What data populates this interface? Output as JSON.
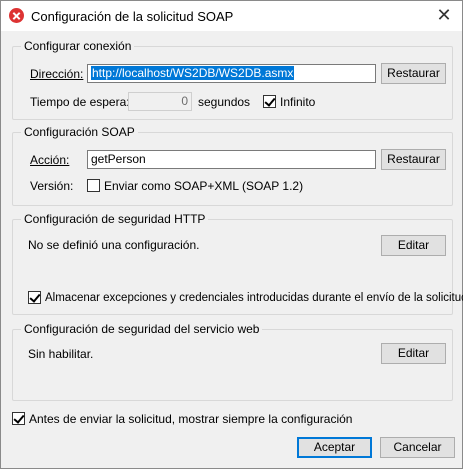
{
  "window": {
    "title": "Configuración de la solicitud SOAP",
    "close_glyph": "✕"
  },
  "connection": {
    "legend": "Configurar conexión",
    "address_label": "Dirección:",
    "address_value": "http://localhost/WS2DB/WS2DB.asmx",
    "restore_label": "Restaurar",
    "timeout_label": "Tiempo de espera:",
    "timeout_value": "0",
    "timeout_unit": "segundos",
    "infinite_label": "Infinito",
    "infinite_checked": true
  },
  "soap": {
    "legend": "Configuración SOAP",
    "action_label": "Acción:",
    "action_value": "getPerson",
    "restore_label": "Restaurar",
    "version_label": "Versión:",
    "soap12_label": "Enviar como SOAP+XML (SOAP 1.2)",
    "soap12_checked": false
  },
  "http_security": {
    "legend": "Configuración de seguridad HTTP",
    "status_text": "No se definió una configuración.",
    "edit_label": "Editar",
    "store_label": "Almacenar excepciones y credenciales introducidas durante el envío de la solicitud",
    "store_checked": true
  },
  "ws_security": {
    "legend": "Configuración de seguridad del servicio web",
    "status_text": "Sin habilitar.",
    "edit_label": "Editar"
  },
  "footer": {
    "always_show_label": "Antes de enviar la solicitud, mostrar siempre la configuración",
    "always_show_checked": true,
    "accept_label": "Aceptar",
    "cancel_label": "Cancelar"
  }
}
